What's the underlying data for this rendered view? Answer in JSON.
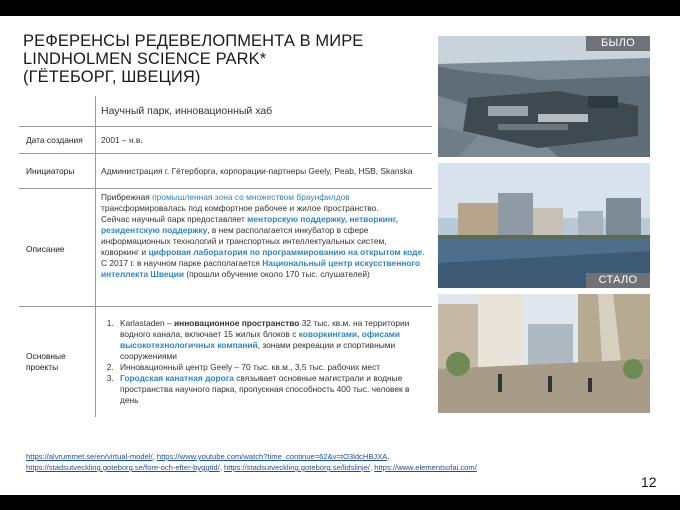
{
  "title": {
    "line1": "РЕФЕРЕНСЫ РЕДЕВЕЛОПМЕНТА В МИРЕ",
    "line2": "LINDHOLMEN SCIENCE PARK*",
    "line3": "(ГЁТЕБОРГ, ШВЕЦИЯ)"
  },
  "table": {
    "heading": "Научный парк, инновационный хаб",
    "created_label": "Дата создания",
    "created_value": "2001 – н.в.",
    "initiators_label": "Инициаторы",
    "initiators_value": "Администрация г. Гётерборга, корпорации-партнеры Geely, Peab, HSB, Skanska",
    "description_label": "Описание",
    "description": {
      "p1a": "Прибрежная ",
      "p1b": "промышленная зона со множеством браунфилдов",
      "p1c": " трансформировалась под комфортное рабочее и жилое пространство.",
      "p2a": "Сейчас научный парк предоставляет ",
      "p2b": "менторскую поддержку, нетворкинг, резидентскую поддержку",
      "p2c": ", в нем располагается инкубатор в сфере информационных технологий и транспортных интеллектуальных систем, коворкинг и ",
      "p2d": "цифровая лаборатория по программированию на открытом коде",
      "p2e": ".",
      "p3a": "С 2017 г. в научном парке располагается ",
      "p3b": "Национальный центр искусственного интеллекта Швеции",
      "p3c": " (прошли обучение около 170 тыс. слушателей)"
    },
    "projects_label": "Основные проекты",
    "projects": {
      "i1a": "Karlastaden – ",
      "i1b": "инновационное пространство",
      "i1c": " 32 тыс. кв.м. на территории водного канала, включает 15 жилых блоков с ",
      "i1d": "коворкингами, офисами высокотехнологичных компаний",
      "i1e": ", зонами рекреации и спортивными сооружениями",
      "i2": "Инновационный центр Geely – 70 тыс. кв.м., 3,5 тыс. рабочих мест",
      "i3a": "Городская канатная дорога",
      "i3b": " связывает основные магистрали и водные пространства научного парка, пропускная способность 400 тыс. человек в день"
    }
  },
  "images": {
    "before_label": "БЫЛО",
    "after_label": "СТАЛО"
  },
  "links": {
    "l1": "https://alvrummet.se/en/virtual-model/",
    "l2": "https://www.youtube.com/watch?time_continue=62&v=tO3ldcHBJXA",
    "l3": "https://stadsutveckling.goteborg.se/fore-och-efter-byggtid/",
    "l4": "https://stadsutveckling.goteborg.se/lidslinje/",
    "l5": "https://www.elementsofai.com/",
    "sep": ", "
  },
  "page_number": "12",
  "colors": {
    "accent": "#2a86c5",
    "label_bg": "#6f7378",
    "bars": "#000000"
  }
}
